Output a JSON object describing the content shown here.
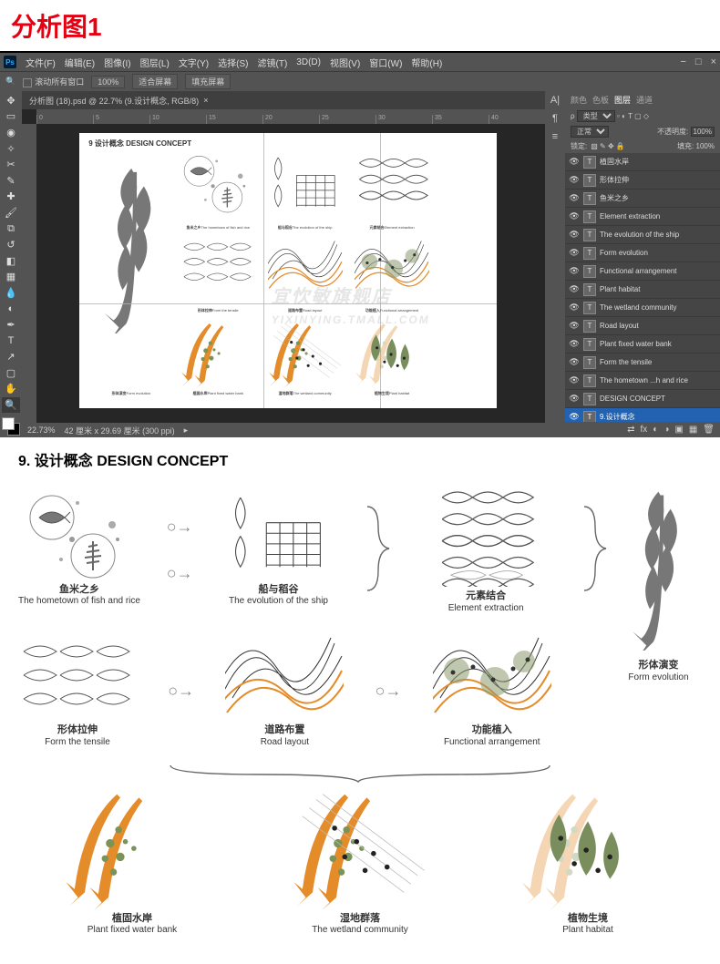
{
  "page_heading": "分析图1",
  "photoshop": {
    "menu": [
      "文件(F)",
      "编辑(E)",
      "图像(I)",
      "图层(L)",
      "文字(Y)",
      "选择(S)",
      "滤镜(T)",
      "3D(D)",
      "视图(V)",
      "窗口(W)",
      "帮助(H)"
    ],
    "options_bar": {
      "scroll_all": "滚动所有窗口",
      "zoom_all": "100%",
      "btn_fit": "适合屏幕",
      "btn_fill": "填充屏幕"
    },
    "doc_tab": "分析图 (18).psd @ 22.7% (9.设计概念, RGB/8)",
    "ruler_marks": [
      "0",
      "5",
      "10",
      "15",
      "20",
      "25",
      "30",
      "35",
      "40"
    ],
    "status": {
      "zoom": "22.73%",
      "size": "42 厘米 x 29.69 厘米 (300 ppi)"
    },
    "panels": {
      "tabs": [
        "颜色",
        "色板",
        "图层",
        "通道"
      ],
      "blend_mode": "正常",
      "opacity_label": "不透明度:",
      "opacity_val": "100%",
      "lock_label": "锁定:",
      "fill_label": "填充:",
      "fill_val": "100%",
      "layer_filter": "类型",
      "layers": [
        {
          "name": "植固水岸",
          "t": "T"
        },
        {
          "name": "形体拉伸",
          "t": "T"
        },
        {
          "name": "鱼米之乡",
          "t": "T"
        },
        {
          "name": "Element extraction",
          "t": "T"
        },
        {
          "name": "The evolution of the ship",
          "t": "T"
        },
        {
          "name": "Form evolution",
          "t": "T"
        },
        {
          "name": "Functional arrangement",
          "t": "T"
        },
        {
          "name": "Plant habitat",
          "t": "T"
        },
        {
          "name": "The wetland community",
          "t": "T"
        },
        {
          "name": "Road layout",
          "t": "T"
        },
        {
          "name": "Plant fixed water bank",
          "t": "T"
        },
        {
          "name": "Form the tensile",
          "t": "T"
        },
        {
          "name": "The hometown ...h and rice",
          "t": "T"
        },
        {
          "name": "DESIGN CONCEPT",
          "t": "T"
        },
        {
          "name": "9.设计概念",
          "t": "T",
          "sel": true
        }
      ]
    },
    "canvas_title": "9 设计概念 DESIGN CONCEPT",
    "canvas_labels": {
      "r1c1_cn": "鱼米之乡",
      "r1c1_en": "The hometown of fish and rice",
      "r1c2_cn": "船与稻谷",
      "r1c2_en": "The evolution of the ship",
      "r1c3_cn": "元素结合",
      "r1c3_en": "Element extraction",
      "r2c1_cn": "形体拉伸",
      "r2c1_en": "Form the tensile",
      "r2c2_cn": "道路布置",
      "r2c2_en": "Road layout",
      "r2c3_cn": "功能植入",
      "r2c3_en": "Functional arrangement",
      "r2c4_cn": "形体演变",
      "r2c4_en": "Form evolution",
      "r3c1_cn": "植固水岸",
      "r3c1_en": "Plant fixed water bank",
      "r3c2_cn": "湿地群落",
      "r3c2_en": "The wetland community",
      "r3c3_cn": "植物生境",
      "r3c3_en": "Plant habitat"
    }
  },
  "concept": {
    "title": "9. 设计概念 DESIGN CONCEPT",
    "row1": [
      {
        "cn": "鱼米之乡",
        "en": "The hometown of fish and rice"
      },
      {
        "cn": "船与稻谷",
        "en": "The evolution of the ship"
      },
      {
        "cn": "元素结合",
        "en": "Element extraction"
      }
    ],
    "row2": [
      {
        "cn": "形体拉伸",
        "en": "Form the tensile"
      },
      {
        "cn": "道路布置",
        "en": "Road layout"
      },
      {
        "cn": "功能植入",
        "en": "Functional arrangement"
      }
    ],
    "bigleaf": {
      "cn": "形体演变",
      "en": "Form evolution"
    },
    "row3": [
      {
        "cn": "植固水岸",
        "en": "Plant fixed water bank"
      },
      {
        "cn": "湿地群落",
        "en": "The wetland community"
      },
      {
        "cn": "植物生境",
        "en": "Plant habitat"
      }
    ]
  },
  "watermark": {
    "line1": "宜忺敏旗舰店",
    "line2": "YIXINYING.TMALL.COM"
  }
}
